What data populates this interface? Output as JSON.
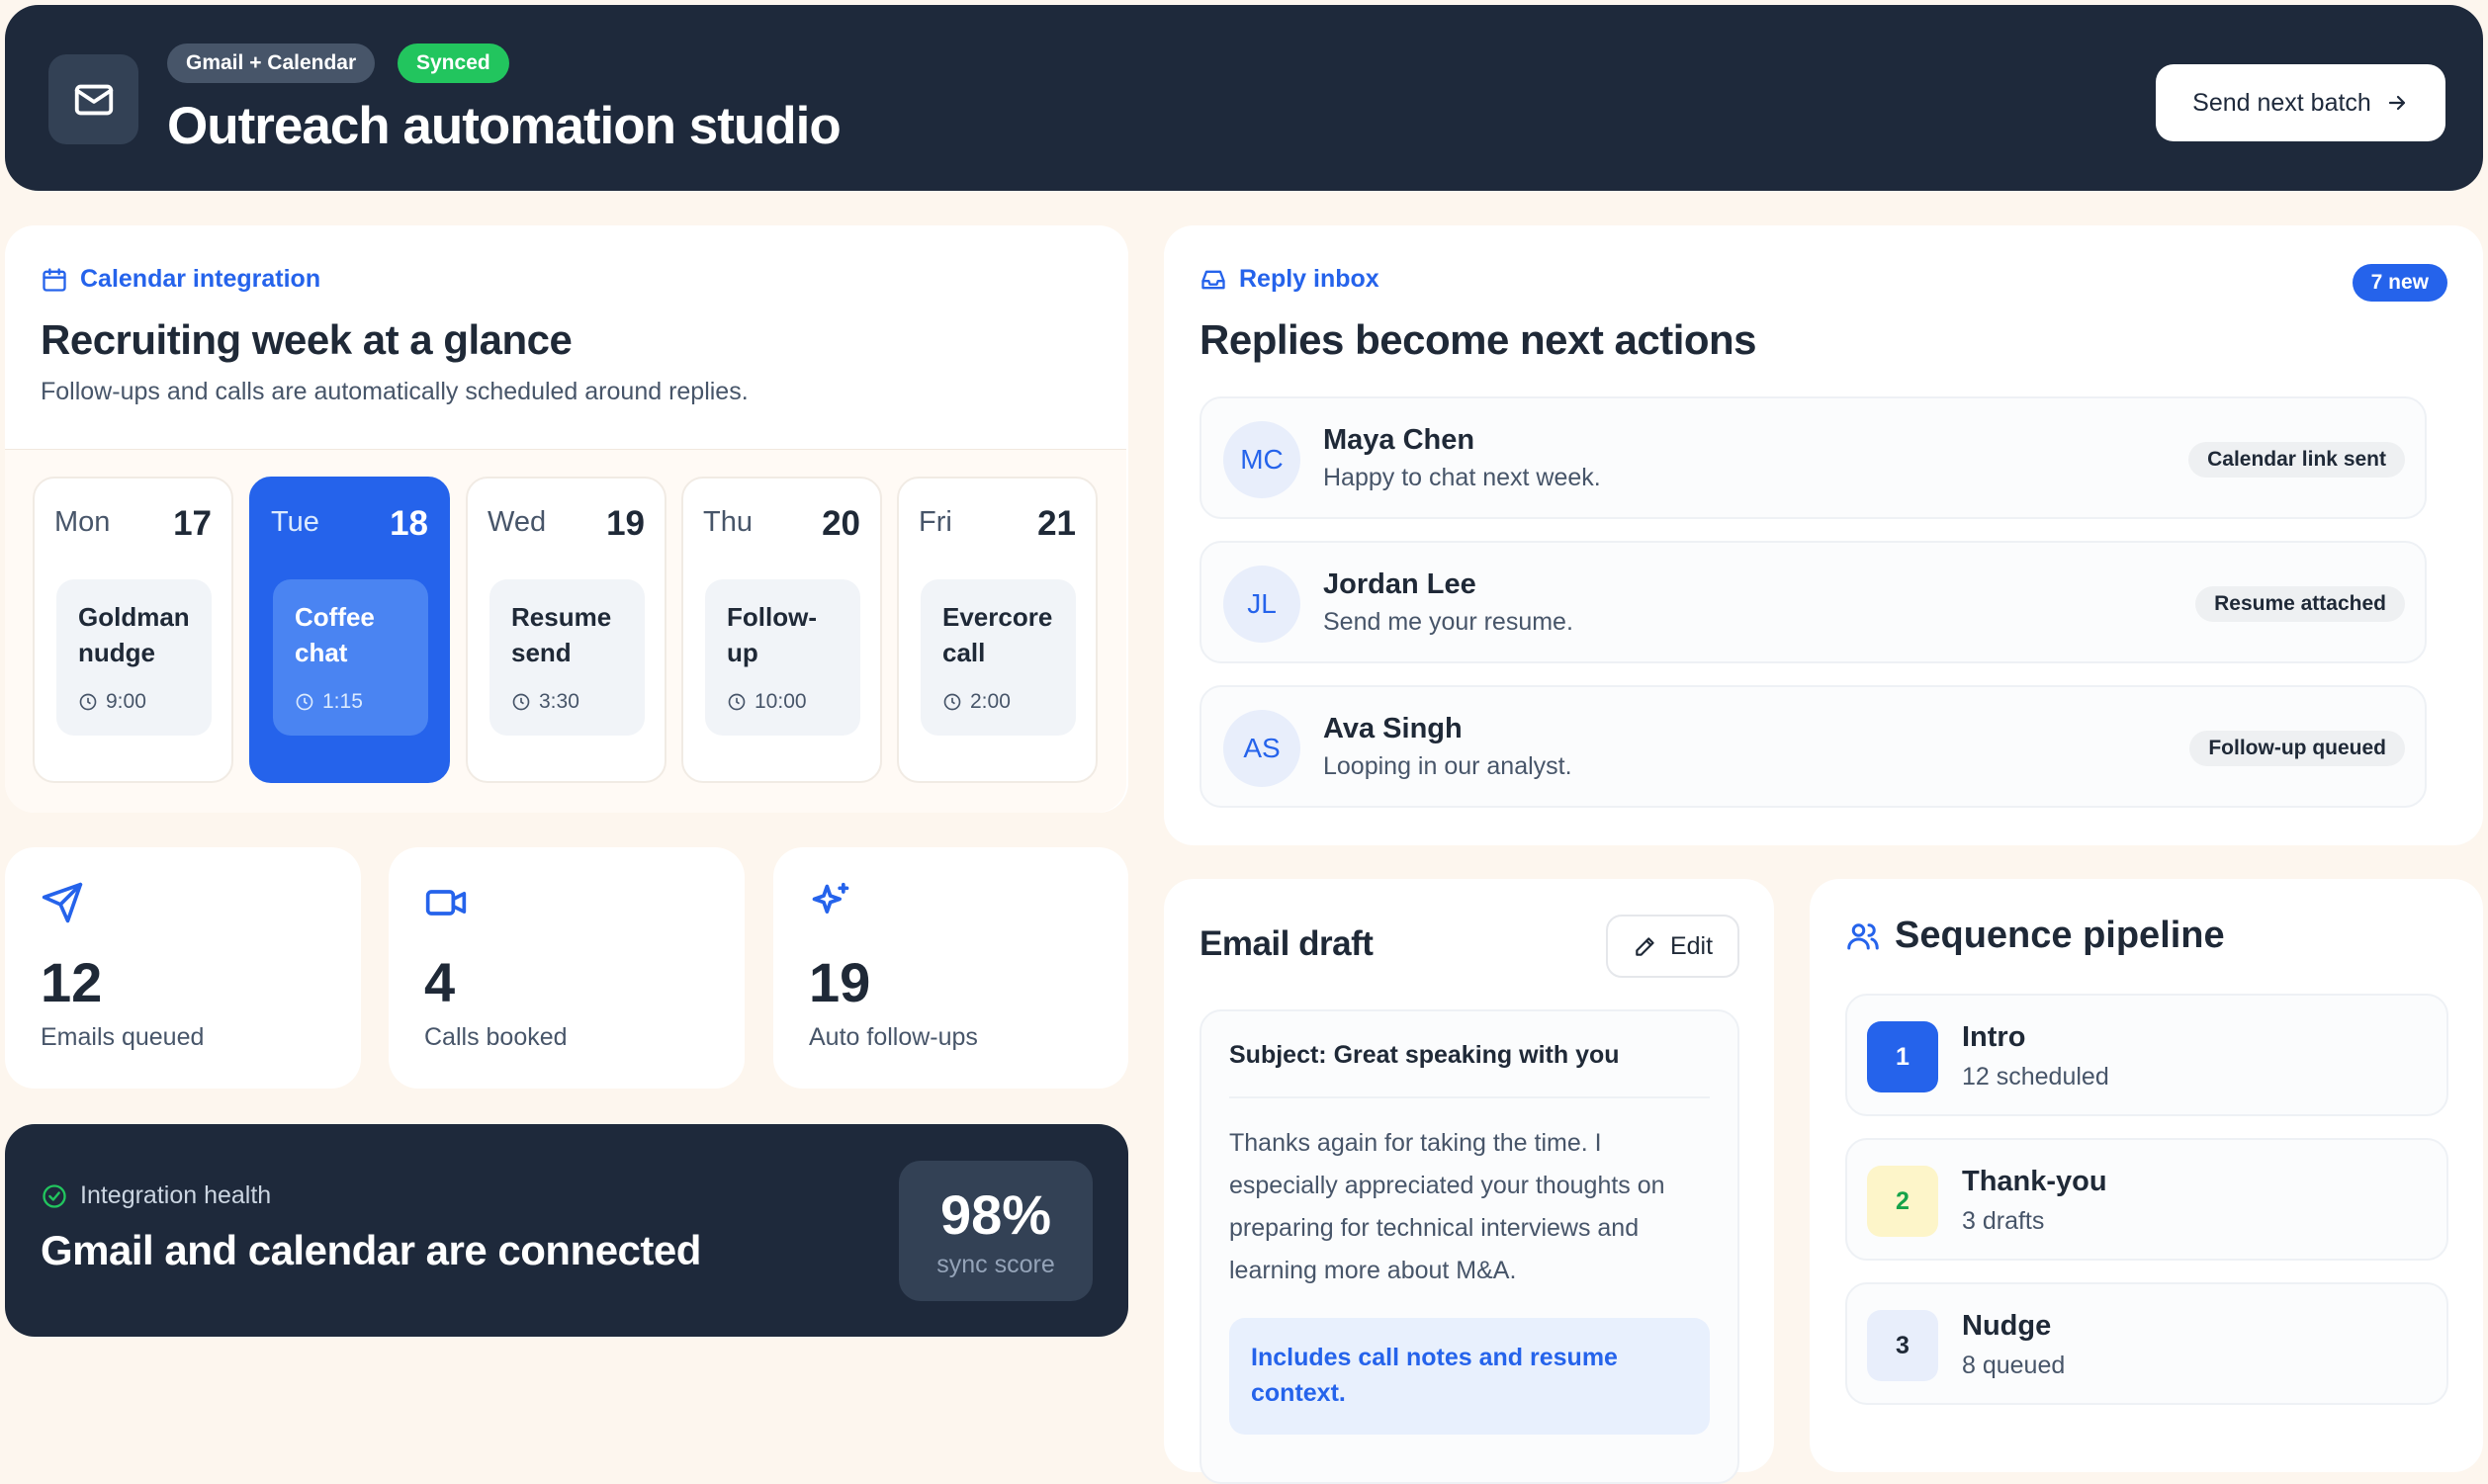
{
  "header": {
    "tag_integration": "Gmail + Calendar",
    "tag_status": "Synced",
    "title": "Outreach automation studio",
    "send_button": "Send next batch"
  },
  "calendar": {
    "eyebrow": "Calendar integration",
    "title": "Recruiting week at a glance",
    "subtitle": "Follow-ups and calls are automatically scheduled around replies.",
    "days": [
      {
        "name": "Mon",
        "num": "17",
        "event_line1": "Goldman",
        "event_line2": "nudge",
        "time": "9:00",
        "active": false
      },
      {
        "name": "Tue",
        "num": "18",
        "event_line1": "Coffee",
        "event_line2": "chat",
        "time": "1:15",
        "active": true
      },
      {
        "name": "Wed",
        "num": "19",
        "event_line1": "Resume",
        "event_line2": "send",
        "time": "3:30",
        "active": false
      },
      {
        "name": "Thu",
        "num": "20",
        "event_line1": "Follow-",
        "event_line2": "up",
        "time": "10:00",
        "active": false
      },
      {
        "name": "Fri",
        "num": "21",
        "event_line1": "Evercore",
        "event_line2": "call",
        "time": "2:00",
        "active": false
      }
    ]
  },
  "stats": [
    {
      "icon": "send-icon",
      "value": "12",
      "label": "Emails queued"
    },
    {
      "icon": "video-icon",
      "value": "4",
      "label": "Calls booked"
    },
    {
      "icon": "sparkles-icon",
      "value": "19",
      "label": "Auto follow-ups"
    }
  ],
  "health": {
    "eyebrow": "Integration health",
    "title": "Gmail and calendar are connected",
    "score": "98%",
    "score_label": "sync score"
  },
  "inbox": {
    "eyebrow": "Reply inbox",
    "badge": "7 new",
    "title": "Replies become next actions",
    "replies": [
      {
        "initials": "MC",
        "name": "Maya Chen",
        "message": "Happy to chat next week.",
        "tag": "Calendar link sent"
      },
      {
        "initials": "JL",
        "name": "Jordan Lee",
        "message": "Send me your resume.",
        "tag": "Resume attached"
      },
      {
        "initials": "AS",
        "name": "Ava Singh",
        "message": "Looping in our analyst.",
        "tag": "Follow-up queued"
      }
    ]
  },
  "draft": {
    "title": "Email draft",
    "edit_button": "Edit",
    "subject": "Subject: Great speaking with you",
    "body_lines": [
      "Thanks again for taking the time. I",
      "especially appreciated your thoughts on",
      "preparing for technical interviews and",
      "learning more about M&A."
    ],
    "note_line1": "Includes call notes and resume",
    "note_line2": "context."
  },
  "pipeline": {
    "title": "Sequence pipeline",
    "steps": [
      {
        "num": "1",
        "name": "Intro",
        "meta": "12 scheduled"
      },
      {
        "num": "2",
        "name": "Thank-you",
        "meta": "3 drafts"
      },
      {
        "num": "3",
        "name": "Nudge",
        "meta": "8 queued"
      }
    ]
  },
  "colors": {
    "accent": "#2563eb",
    "dark": "#1e293b",
    "success": "#22c55e",
    "background": "#fdf6ee"
  }
}
